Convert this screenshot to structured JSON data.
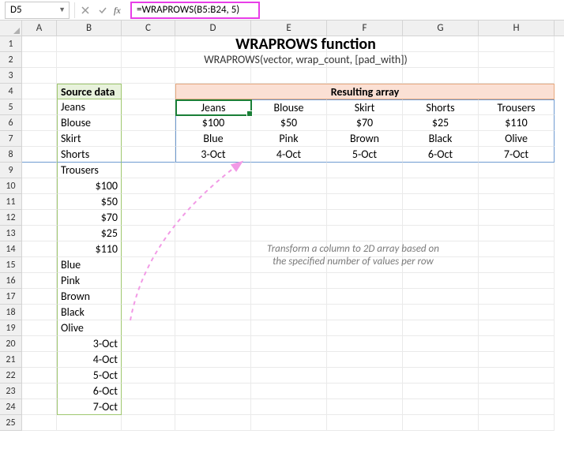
{
  "name_box": "D5",
  "formula": "=WRAPROWS(B5:B24, 5)",
  "columns": [
    "A",
    "B",
    "C",
    "D",
    "E",
    "F",
    "G",
    "H"
  ],
  "rows": [
    "1",
    "2",
    "3",
    "4",
    "5",
    "6",
    "7",
    "8",
    "9",
    "10",
    "11",
    "12",
    "13",
    "14",
    "15",
    "16",
    "17",
    "18",
    "19",
    "20",
    "21",
    "22",
    "23",
    "24",
    "25"
  ],
  "title": "WRAPROWS function",
  "syntax": "WRAPROWS(vector, wrap_count, [pad_with])",
  "source_header": "Source data",
  "result_header": "Resulting array",
  "source_data": [
    "Jeans",
    "Blouse",
    "Skirt",
    "Shorts",
    "Trousers",
    "$100",
    "$50",
    "$70",
    "$25",
    "$110",
    "Blue",
    "Pink",
    "Brown",
    "Black",
    "Olive",
    "3-Oct",
    "4-Oct",
    "5-Oct",
    "6-Oct",
    "7-Oct"
  ],
  "result_array": [
    [
      "Jeans",
      "Blouse",
      "Skirt",
      "Shorts",
      "Trousers"
    ],
    [
      "$100",
      "$50",
      "$70",
      "$25",
      "$110"
    ],
    [
      "Blue",
      "Pink",
      "Brown",
      "Black",
      "Olive"
    ],
    [
      "3-Oct",
      "4-Oct",
      "5-Oct",
      "6-Oct",
      "7-Oct"
    ]
  ],
  "annotation_line1": "Transform a column to 2D array based on",
  "annotation_line2": "the specified number of values per row"
}
